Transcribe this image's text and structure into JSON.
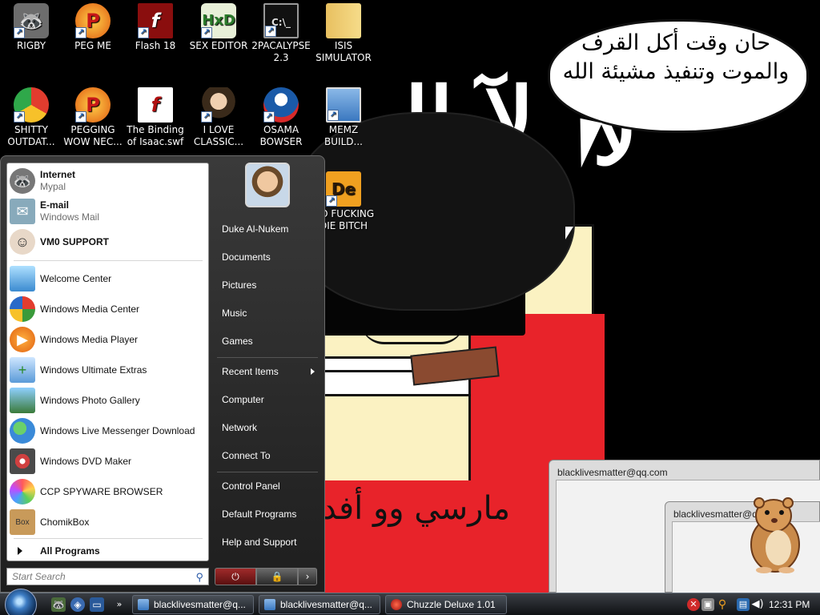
{
  "wallpaper": {
    "bubble_line1": "حان وقت أكل القرف",
    "bubble_line2": "والموت وتنفيذ مشيئة الله",
    "shirt_text": "مارسي وو أفد"
  },
  "desktop_icons": [
    {
      "label": "RIGBY",
      "icon": "raccoon-icon"
    },
    {
      "label": "PEG ME",
      "icon": "peggle-icon"
    },
    {
      "label": "Flash 18",
      "icon": "flash-icon"
    },
    {
      "label": "SEX EDITOR",
      "icon": "hex-editor-icon"
    },
    {
      "label": "2PACALYPSE 2.3",
      "icon": "console-icon"
    },
    {
      "label": "ISIS SIMULATOR",
      "icon": "folder-icon"
    },
    {
      "label": "SHITTY OUTDAT...",
      "icon": "chrome-icon"
    },
    {
      "label": "PEGGING WOW NEC...",
      "icon": "peggle-icon"
    },
    {
      "label": "The Binding of Isaac.swf",
      "icon": "flash-file-icon"
    },
    {
      "label": "I LOVE CLASSIC...",
      "icon": "portrait-icon"
    },
    {
      "label": "OSAMA BOWSER",
      "icon": "obama-logo-icon"
    },
    {
      "label": "MEMZ BUILD...",
      "icon": "window-icon"
    },
    {
      "label": "GO FUCKING DIE BITCH",
      "icon": "de-icon"
    }
  ],
  "start_menu": {
    "pinned": [
      {
        "title": "Internet",
        "subtitle": "Mypal"
      },
      {
        "title": "E-mail",
        "subtitle": "Windows Mail"
      },
      {
        "title": "VM0 SUPPORT",
        "subtitle": ""
      }
    ],
    "recent": [
      "Welcome Center",
      "Windows Media Center",
      "Windows Media Player",
      "Windows Ultimate Extras",
      "Windows Photo Gallery",
      "Windows Live Messenger Download",
      "Windows DVD Maker",
      "CCP SPYWARE BROWSER",
      "ChomikBox"
    ],
    "all_programs": "All Programs",
    "search_placeholder": "Start Search",
    "right_items": [
      "Duke Al-Nukem",
      "Documents",
      "Pictures",
      "Music",
      "Games",
      "Recent Items",
      "Computer",
      "Network",
      "Connect To",
      "Control Panel",
      "Default Programs",
      "Help and Support"
    ]
  },
  "windows": {
    "win1_title": "blacklivesmatter@qq.com",
    "win2_title": "blacklivesmatter@qq.com"
  },
  "taskbar": {
    "buttons": [
      "blacklivesmatter@q...",
      "blacklivesmatter@q...",
      "Chuzzle Deluxe 1.01"
    ],
    "clock": "12:31 PM"
  },
  "colors": {
    "wallpaper_bg": "#000000",
    "shirt_red": "#e8232a",
    "skin": "#fbf2c2",
    "start_menu_dark": "#1e1e1e",
    "taskbar": "#0f1114"
  }
}
